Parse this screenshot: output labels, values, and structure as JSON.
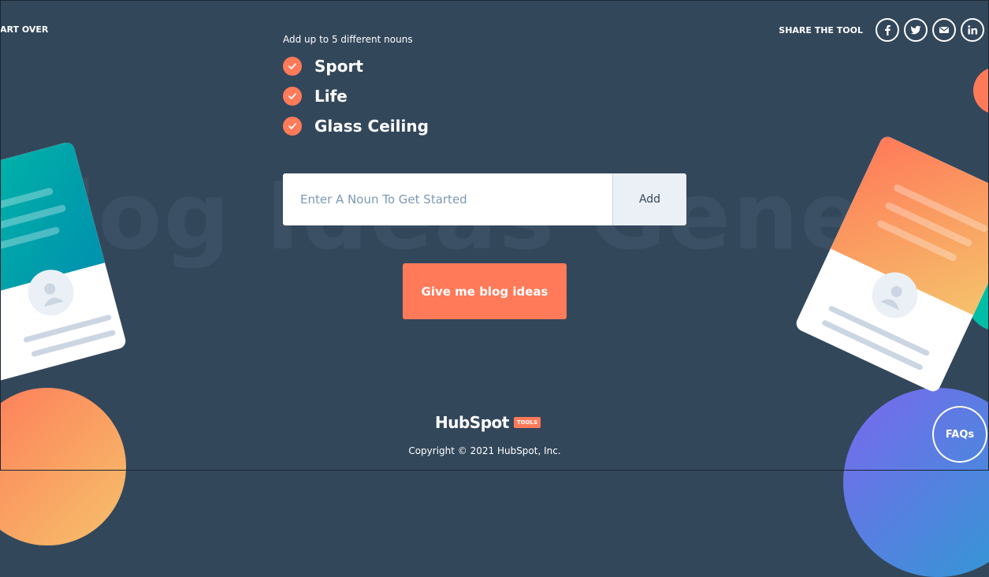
{
  "header": {
    "start_over_label": "ART OVER",
    "share_label": "SHARE THE TOOL",
    "share_buttons": [
      "facebook-icon",
      "twitter-icon",
      "email-icon",
      "linkedin-icon"
    ]
  },
  "watermark_text": "Blog Ideas Generator",
  "nouns": {
    "hint": "Add up to 5 different nouns",
    "items": [
      "Sport",
      "Life",
      "Glass Ceiling"
    ]
  },
  "form": {
    "placeholder": "Enter A Noun To Get Started",
    "add_label": "Add"
  },
  "cta_label": "Give me blog ideas",
  "footer": {
    "logo_text": "HubSpot",
    "badge": "TOOLS",
    "copyright": "Copyright © 2021 HubSpot, Inc."
  },
  "faqs_label": "FAQs",
  "colors": {
    "background": "#33475b",
    "accent": "#ff7a59",
    "teal": "#00bda5",
    "input_bg": "#ffffff",
    "add_bg": "#eaf0f6"
  }
}
